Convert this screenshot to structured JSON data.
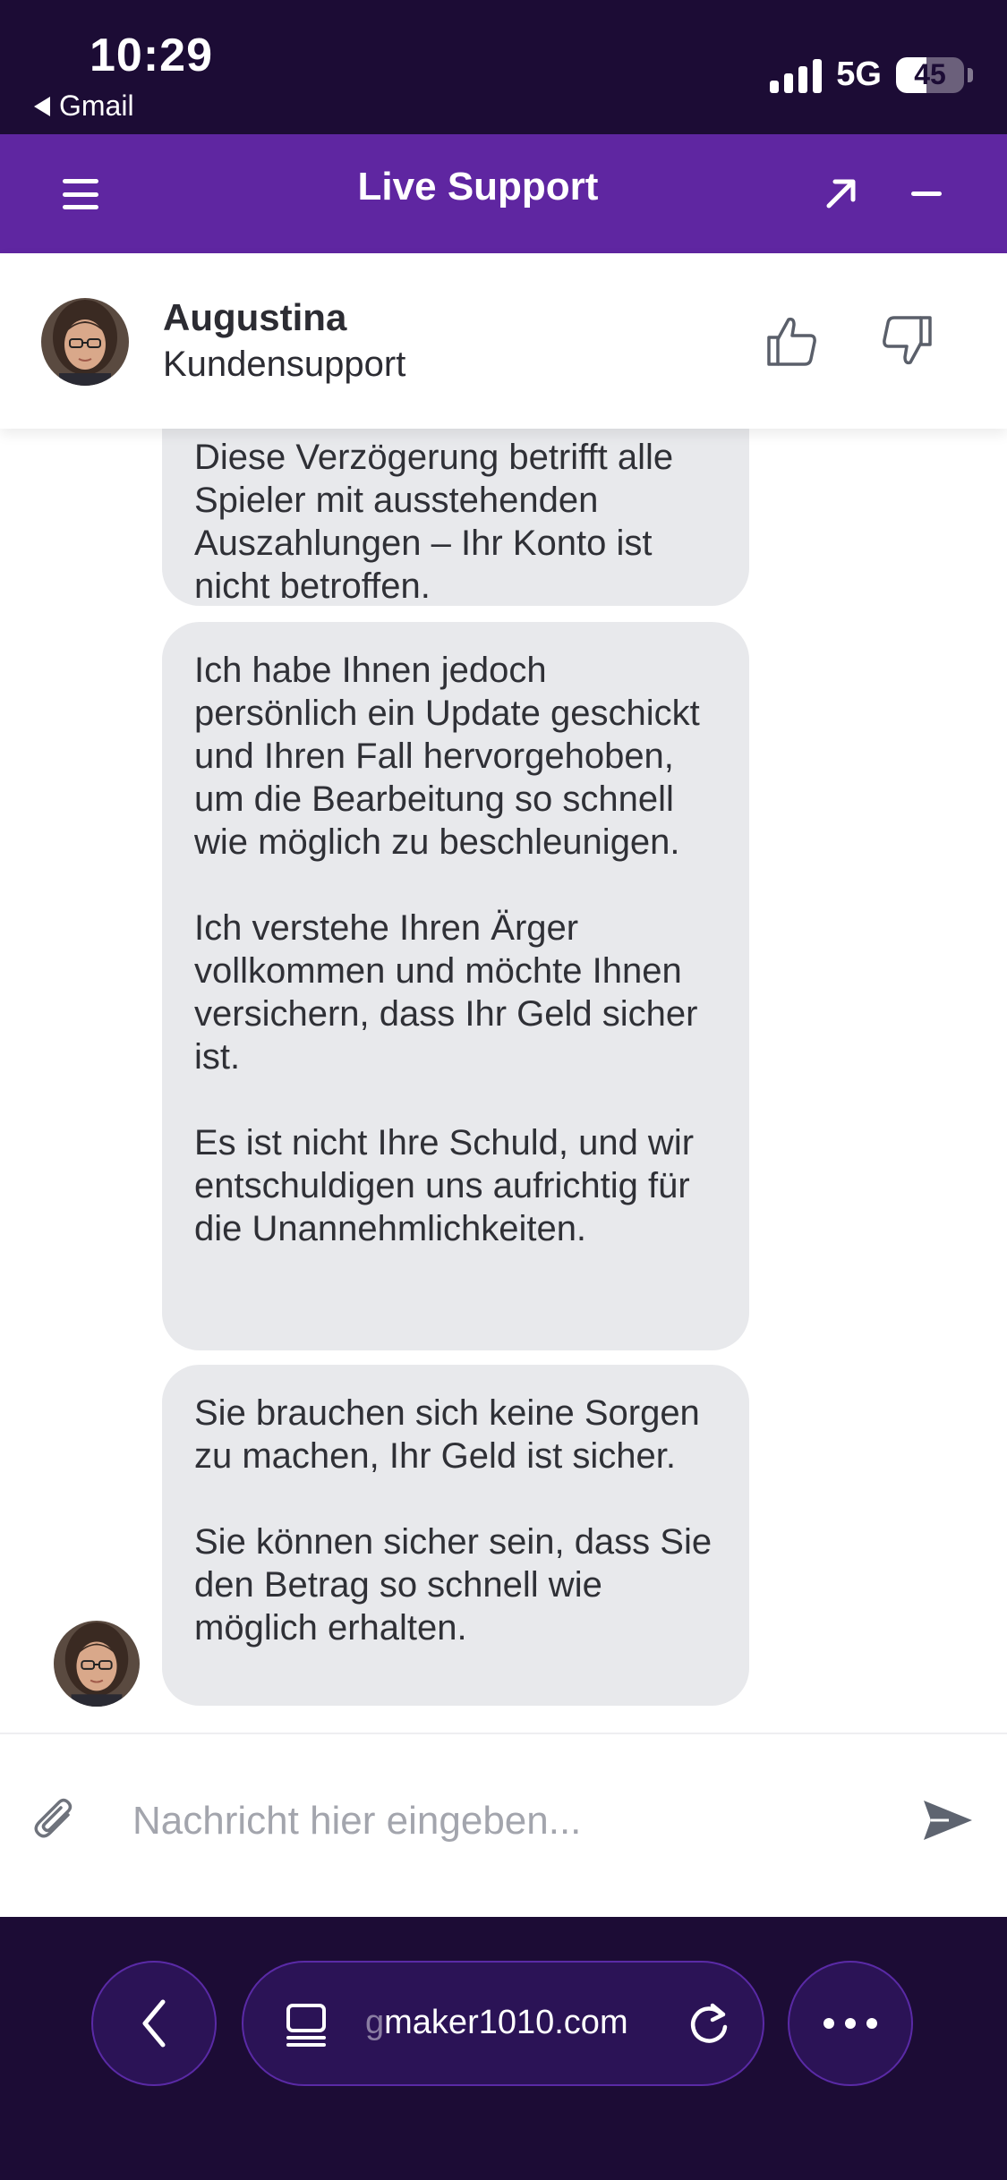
{
  "status_bar": {
    "time": "10:29",
    "back_app": "Gmail",
    "network": "5G",
    "battery": "45",
    "battery_level": 0.45
  },
  "header": {
    "title": "Live Support",
    "icons": [
      "menu-icon",
      "popout-arrow-icon",
      "minimize-icon"
    ]
  },
  "agent": {
    "name": "Augustina",
    "role": "Kundensupport",
    "rating_icons": [
      "thumbs-up-icon",
      "thumbs-down-icon"
    ]
  },
  "messages": [
    {
      "paragraphs": [
        "Diese Verzögerung betrifft alle Spieler mit ausstehenden Auszahlungen – Ihr Konto ist nicht betroffen."
      ]
    },
    {
      "paragraphs": [
        "Ich habe Ihnen jedoch persönlich ein Update geschickt und Ihren Fall hervorgehoben, um die Bearbeitung so schnell wie möglich zu beschleunigen.",
        "Ich verstehe Ihren Ärger vollkommen und möchte Ihnen versichern, dass Ihr Geld sicher ist.",
        "Es ist nicht Ihre Schuld, und wir entschuldigen uns aufrichtig für die Unannehmlichkeiten."
      ]
    },
    {
      "paragraphs": [
        "Sie brauchen sich keine Sorgen zu machen, Ihr Geld ist sicher.",
        "Sie können sicher sein, dass Sie den Betrag so schnell wie möglich erhalten."
      ]
    }
  ],
  "composer": {
    "placeholder": "Nachricht hier eingeben...",
    "value": ""
  },
  "browser": {
    "url_fade": "g",
    "url": "maker1010.com"
  },
  "colors": {
    "header_purple": "#5f26a1",
    "dark_bg": "#1c0c35",
    "bubble_gray": "#e8e9ec"
  }
}
